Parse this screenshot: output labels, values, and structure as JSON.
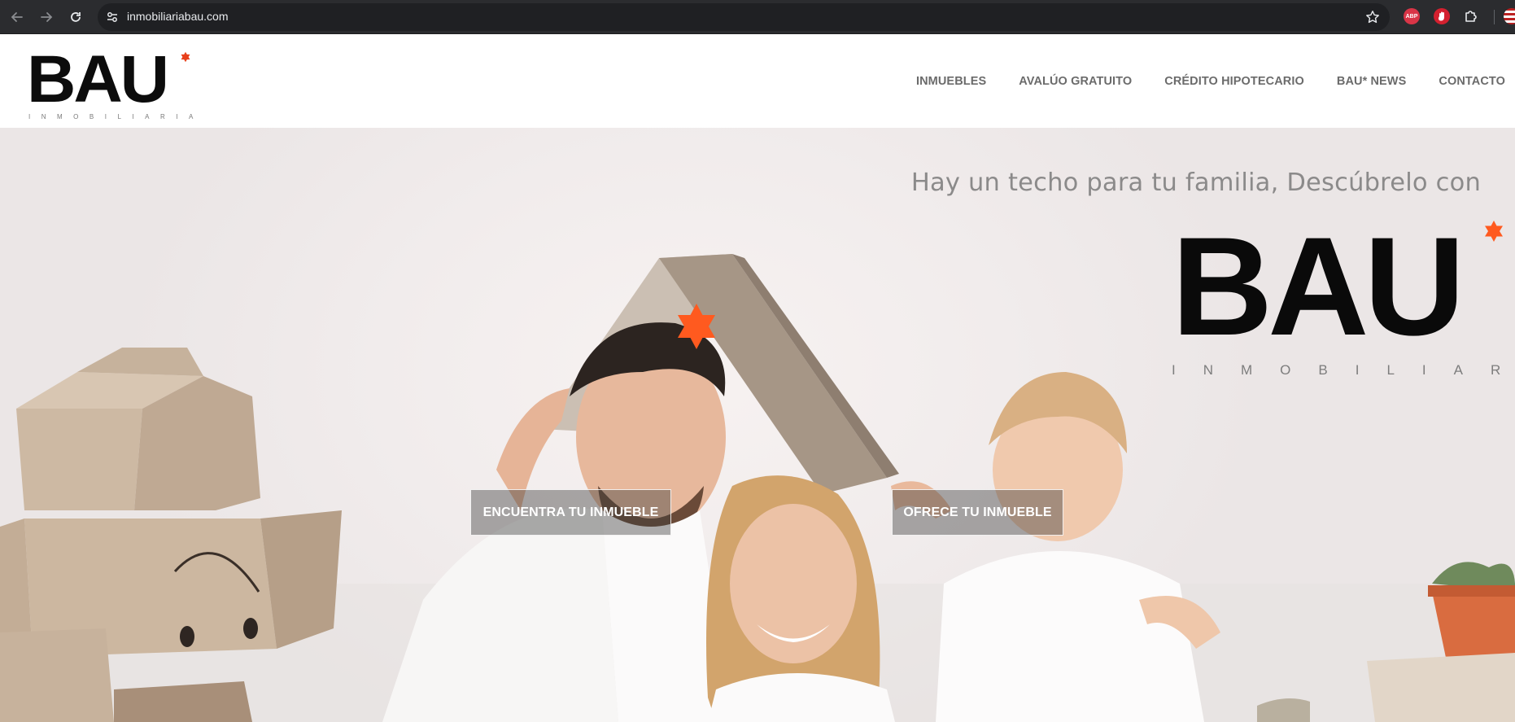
{
  "browser": {
    "url": "inmobiliariabau.com",
    "extensions": [
      {
        "name": "adblock-plus",
        "label": "ABP"
      },
      {
        "name": "hand-extension"
      },
      {
        "name": "extensions-puzzle"
      }
    ]
  },
  "header": {
    "logo": {
      "main": "BAU",
      "sub": "INMOBILIARIA",
      "star_color": "#e8401b"
    },
    "nav": [
      {
        "label": "INMUEBLES"
      },
      {
        "label": "AVALÚO GRATUITO"
      },
      {
        "label": "CRÉDITO HIPOTECARIO"
      },
      {
        "label": "BAU* NEWS"
      },
      {
        "label": "CONTACTO"
      }
    ]
  },
  "hero": {
    "tagline": "Hay un techo para tu familia, Descúbrelo con",
    "logo": {
      "main": "BAU",
      "sub": "INMOBILIARIA"
    },
    "buttons": {
      "find": "ENCUENTRA TU INMUEBLE",
      "offer": "OFRECE TU INMUEBLE"
    },
    "accent_color": "#ff5a1f"
  }
}
